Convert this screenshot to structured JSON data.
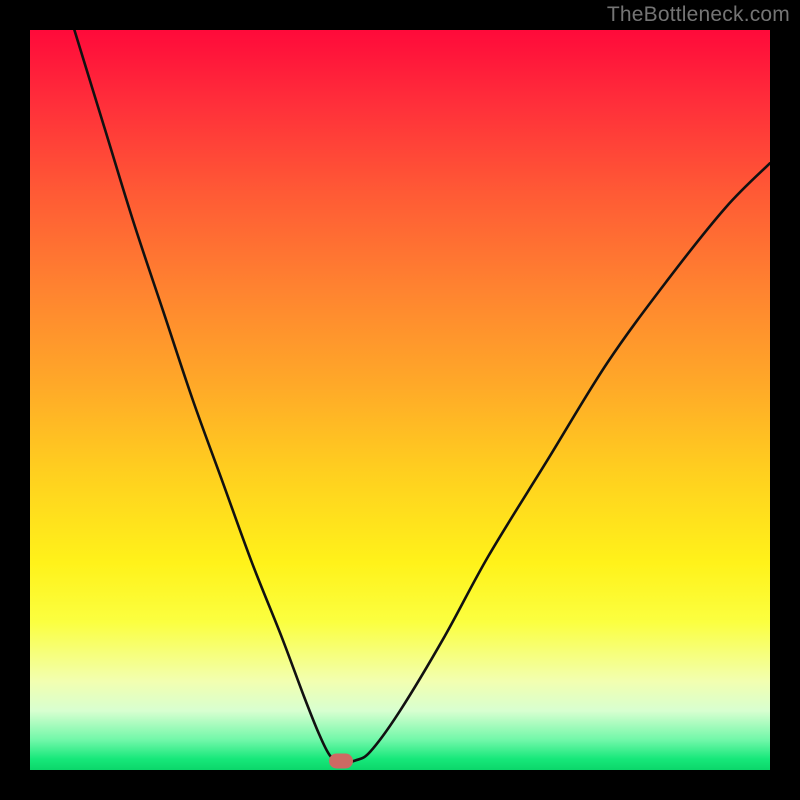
{
  "watermark": "TheBottleneck.com",
  "colors": {
    "frame": "#000000",
    "curve_stroke": "#111111",
    "marker_fill": "#cd6a63",
    "watermark_text": "#747474",
    "gradient_top": "#ff0a3a",
    "gradient_bottom": "#0bd66a"
  },
  "chart_data": {
    "type": "line",
    "title": "",
    "xlabel": "",
    "ylabel": "",
    "xlim": [
      0,
      100
    ],
    "ylim": [
      0,
      100
    ],
    "grid": false,
    "legend": false,
    "annotations": [
      "TheBottleneck.com"
    ],
    "marker": {
      "x": 42,
      "y": 1.2
    },
    "series": [
      {
        "name": "bottleneck-curve",
        "x": [
          6,
          10,
          14,
          18,
          22,
          26,
          30,
          34,
          37,
          39,
          40.5,
          42,
          44,
          46,
          50,
          56,
          62,
          70,
          78,
          86,
          94,
          100
        ],
        "y": [
          100,
          87,
          74,
          62,
          50,
          39,
          28,
          18,
          10,
          5,
          2,
          1,
          1.3,
          2.5,
          8,
          18,
          29,
          42,
          55,
          66,
          76,
          82
        ]
      }
    ]
  }
}
